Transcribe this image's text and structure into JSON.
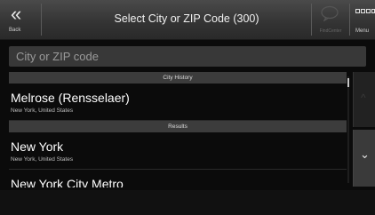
{
  "header": {
    "back_label": "Back",
    "back_icon": "«",
    "title": "Select City or ZIP Code (300)",
    "findcenter_label": "FindCenter",
    "menu_label": "Menu"
  },
  "search": {
    "placeholder": "City or ZIP code",
    "value": ""
  },
  "list": {
    "history_header": "City History",
    "history_items": [
      {
        "title": "Melrose (Rensselaer)",
        "subtitle": "New York, United States"
      }
    ],
    "results_header": "Results",
    "result_items": [
      {
        "title": "New York",
        "subtitle": "New York, United States"
      },
      {
        "title": "New York City Metro",
        "subtitle": ""
      }
    ]
  },
  "scroll": {
    "up_icon": "^",
    "down_icon": "⌄"
  }
}
